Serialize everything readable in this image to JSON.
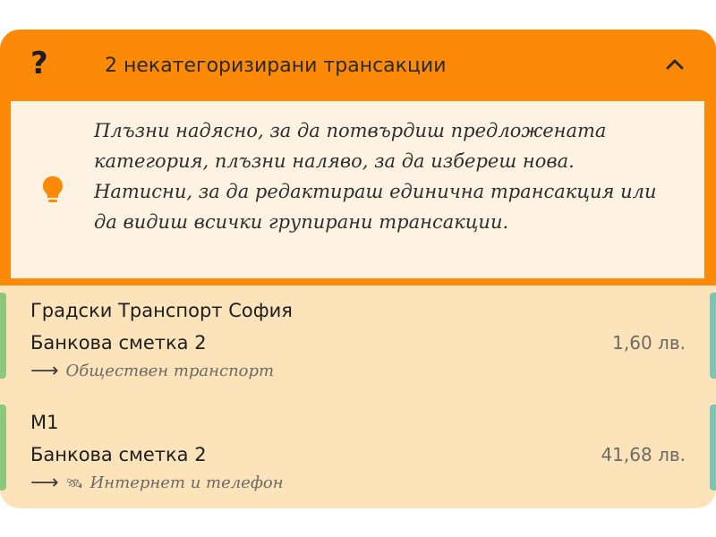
{
  "header": {
    "icon": "question-mark-icon",
    "title": "2 некатегоризирани трансакции",
    "collapse_icon": "chevron-up-icon",
    "accent_color": "#fc8a08"
  },
  "tip": {
    "icon": "lightbulb-icon",
    "text": "Плъзни надясно, за да потвърдиш предложената категория, плъзни наляво, за да избереш нова. Натисни, за да редактираш единична трансакция или да видиш всички групирани трансакции."
  },
  "transactions": [
    {
      "merchant": "Градски Транспорт София",
      "account": "Банкова сметка 2",
      "amount": "1,60 лв.",
      "category": "Обществен транспорт",
      "category_icon": ""
    },
    {
      "merchant": "М1",
      "account": "Банкова сметка 2",
      "amount": "41,68 лв.",
      "category": "Интернет и телефон",
      "category_icon": "🛰"
    }
  ]
}
